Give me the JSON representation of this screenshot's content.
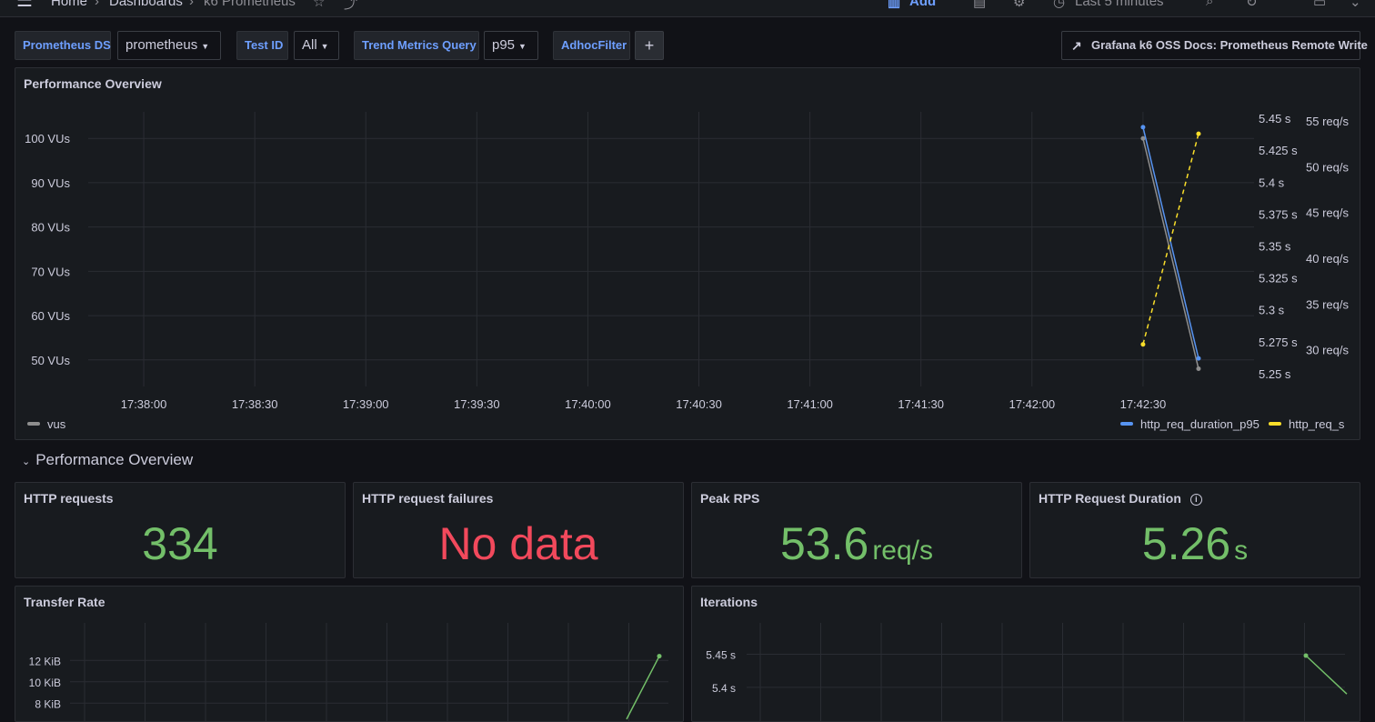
{
  "topbar": {
    "crumbs": [
      "Home",
      "Dashboards",
      "k6 Prometheus"
    ],
    "add_label": "Add",
    "time_range": "Last 5 minutes"
  },
  "variables": [
    {
      "label": "Prometheus DS",
      "value": "prometheus"
    },
    {
      "label": "Test ID",
      "value": "All"
    },
    {
      "label": "Trend Metrics Query",
      "value": "p95"
    },
    {
      "label": "AdhocFilter",
      "value": "+"
    }
  ],
  "docs_link": "Grafana k6 OSS Docs: Prometheus Remote Write",
  "colors": {
    "blue": "#5794f2",
    "yellow": "#fade2a",
    "grey": "#8e8e8e",
    "green": "#73bf69",
    "red": "#f2495c",
    "accent": "#6e9fff"
  },
  "overview_panel": {
    "title": "Performance Overview",
    "legend_left": "vus",
    "legend_right": [
      "http_req_duration_p95",
      "http_req_s"
    ]
  },
  "row": {
    "title": "Performance Overview"
  },
  "stats": [
    {
      "title": "HTTP requests",
      "value": "334",
      "unit": "",
      "color": "#73bf69",
      "info": false
    },
    {
      "title": "HTTP request failures",
      "value": "No data",
      "unit": "",
      "color": "#f2495c",
      "info": false
    },
    {
      "title": "Peak RPS",
      "value": "53.6",
      "unit": "req/s",
      "color": "#73bf69",
      "info": false
    },
    {
      "title": "HTTP Request Duration",
      "value": "5.26",
      "unit": "s",
      "color": "#73bf69",
      "info": true
    }
  ],
  "transfer_panel": {
    "title": "Transfer Rate"
  },
  "iterations_panel": {
    "title": "Iterations"
  },
  "chart_data": [
    {
      "type": "line",
      "title": "Performance Overview",
      "x_ticks": [
        "17:38:00",
        "17:38:30",
        "17:39:00",
        "17:39:30",
        "17:40:00",
        "17:40:30",
        "17:41:00",
        "17:41:30",
        "17:42:00",
        "17:42:30"
      ],
      "y_left_ticks": [
        "100 VUs",
        "90 VUs",
        "80 VUs",
        "70 VUs",
        "60 VUs",
        "50 VUs"
      ],
      "y_left_lim": [
        44,
        106
      ],
      "y_mid_ticks": [
        "5.45 s",
        "5.425 s",
        "5.4 s",
        "5.375 s",
        "5.35 s",
        "5.325 s",
        "5.3 s",
        "5.275 s",
        "5.25 s"
      ],
      "y_mid_lim": [
        5.24,
        5.455
      ],
      "y_right_ticks": [
        "55 req/s",
        "50 req/s",
        "45 req/s",
        "40 req/s",
        "35 req/s",
        "30 req/s"
      ],
      "y_right_lim": [
        26,
        56
      ],
      "x_range": [
        "17:37:45",
        "17:43:00"
      ],
      "series": [
        {
          "name": "vus",
          "axis": "left",
          "color": "#8e8e8e",
          "dashed": false,
          "x": [
            "17:42:30",
            "17:42:45"
          ],
          "values": [
            100,
            48
          ]
        },
        {
          "name": "http_req_duration_p95",
          "axis": "mid",
          "color": "#5794f2",
          "dashed": false,
          "x": [
            "17:42:30",
            "17:42:45"
          ],
          "values": [
            5.443,
            5.262
          ]
        },
        {
          "name": "http_req_s",
          "axis": "right",
          "color": "#fade2a",
          "dashed": true,
          "x": [
            "17:42:30",
            "17:42:45"
          ],
          "values": [
            30.6,
            53.6
          ]
        }
      ],
      "grid": true,
      "legend": "bottom"
    },
    {
      "type": "line",
      "title": "Transfer Rate",
      "y_ticks": [
        "12 KiB",
        "10 KiB",
        "8 KiB"
      ],
      "y_lim": [
        7,
        13.3
      ],
      "series": [
        {
          "name": "",
          "color": "#73bf69",
          "x": [
            "17:42:00",
            "17:42:30"
          ],
          "values": [
            6.5,
            12.4
          ]
        }
      ],
      "grid": true
    },
    {
      "type": "line",
      "title": "Iterations",
      "y_ticks": [
        "5.45 s",
        "5.4 s"
      ],
      "y_lim": [
        5.36,
        5.47
      ],
      "series": [
        {
          "name": "",
          "color": "#73bf69",
          "x": [
            "17:42:30",
            "17:42:45"
          ],
          "values": [
            5.448,
            5.39
          ]
        }
      ],
      "grid": true
    }
  ]
}
